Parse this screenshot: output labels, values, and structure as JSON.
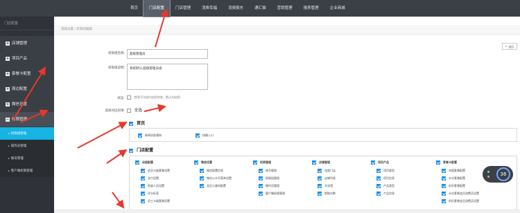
{
  "nav": [
    "首页",
    "门店配置",
    "门店管理",
    "消费幸福",
    "消费股东",
    "通汇猫",
    "营销管理",
    "报表管理",
    "企业商城"
  ],
  "sidebar": {
    "title": "门店配置",
    "items": [
      {
        "label": "店铺管理"
      },
      {
        "label": "项目产品"
      },
      {
        "label": "套餐卡配置"
      },
      {
        "label": "周边配置"
      },
      {
        "label": "微信设置"
      },
      {
        "label": "权限管理"
      }
    ],
    "subitems": [
      "权限组管理",
      "操作员管理",
      "账号管理",
      "客户端权限管理"
    ]
  },
  "breadcrumb": "基础设置  |  权限组编辑",
  "back_label": "返回",
  "form": {
    "name_label": "权限组名称:",
    "name_value": "超级管理员",
    "desc_label": "权限组说明:",
    "desc_value": "系统默认,超级管理员组",
    "status_label": "状态:",
    "status_text": "禁用(不勾选为启用状态，默认为启用)",
    "selall_label": "选择对应权限:",
    "selall_text": "全选"
  },
  "groups": [
    {
      "title": "首页",
      "items": [
        "新闻消息通知",
        "快捷入口"
      ]
    },
    {
      "title": "门店配置",
      "columns": [
        {
          "head": "店面配置",
          "items": [
            "会员卡级套餐设置",
            "支付设置",
            "防盗人员设置",
            "评分标签",
            "员工卡级套餐设置"
          ]
        },
        {
          "head": "微信设置",
          "items": [
            "微信配置信息",
            "微信公众号菜单设置",
            "会员二维码配置"
          ]
        },
        {
          "head": "权限管理",
          "items": [
            "账号管理",
            "权限组管理",
            "操作员管理",
            "客户端权限管理"
          ]
        },
        {
          "head": "店铺管理",
          "items": [
            "连锁门店",
            "店铺列表",
            "文化墙",
            "提取次数"
          ]
        },
        {
          "head": "项目产品",
          "items": [
            "项目类型",
            "项目信息",
            "产品类型",
            "产品信息"
          ]
        },
        {
          "head": "套餐卡配置",
          "items": [
            "充值套餐配置",
            "计次套餐配置",
            "折扣套餐配置",
            "计次套餐会员消费买设置",
            "折扣套餐会员消费买设置"
          ]
        }
      ]
    }
  ],
  "badge_value": "36",
  "colors": {
    "nav_bg": "#3b3f46",
    "sidebar_bg": "#2f3238",
    "active": "#16b3e3",
    "checkbox": "#1a8fe8",
    "arrow": "#e8372c"
  }
}
